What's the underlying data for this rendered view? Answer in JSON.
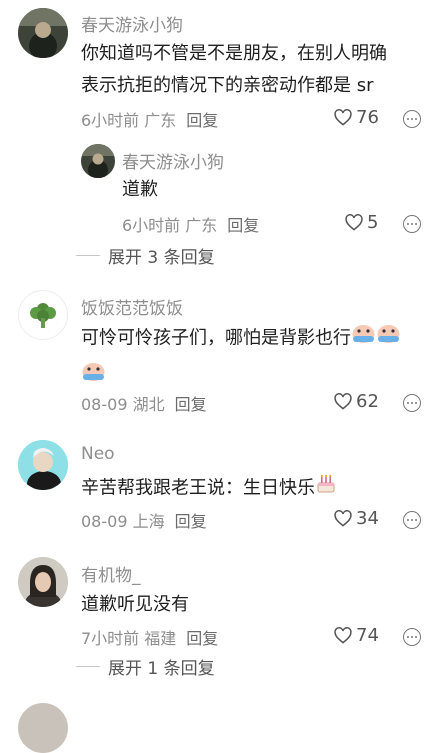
{
  "comments": [
    {
      "name": "春天游泳小狗",
      "text": "你知道吗不管是不是朋友，在别人明确表示抗拒的情况下的亲密动作都是 sr",
      "meta": "6小时前 广东",
      "reply": "回复",
      "likes": "76",
      "subreply": {
        "name": "春天游泳小狗",
        "text": "道歉",
        "meta": "6小时前 广东",
        "reply": "回复",
        "likes": "5"
      },
      "expand": "展开 3 条回复"
    },
    {
      "name": "饭饭范范饭饭",
      "text": "可怜可怜孩子们，哪怕是背影也行",
      "meta": "08-09 湖北",
      "reply": "回复",
      "likes": "62"
    },
    {
      "name": "Neo",
      "text": "辛苦帮我跟老王说：生日快乐",
      "meta": "08-09 上海",
      "reply": "回复",
      "likes": "34"
    },
    {
      "name": "有机物_",
      "text": "道歉听见没有",
      "meta": "7小时前 福建",
      "reply": "回复",
      "likes": "74",
      "expand": "展开 1 条回复"
    }
  ],
  "icons": {
    "like": "heart-outline-icon",
    "more": "more-circle-icon"
  }
}
